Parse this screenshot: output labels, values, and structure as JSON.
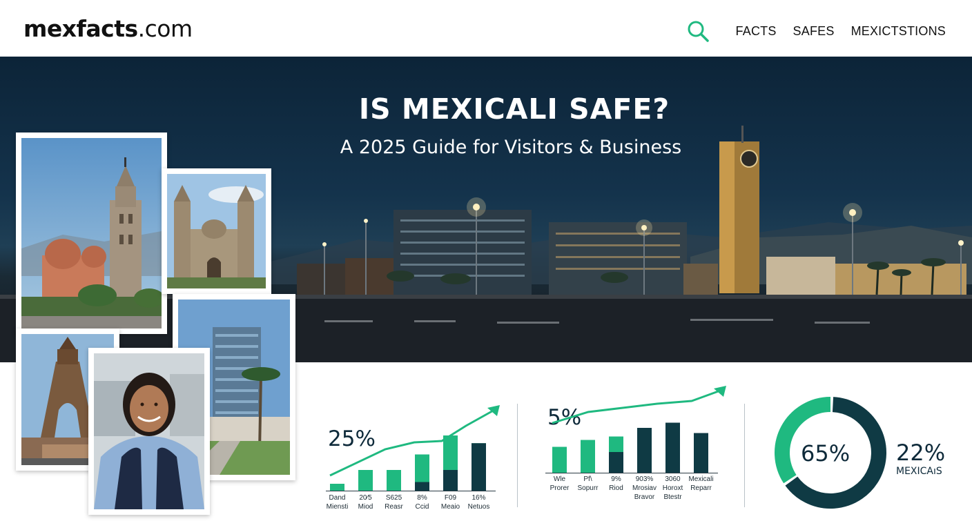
{
  "site": {
    "logo_bold": "mexfacts",
    "logo_tld": ".com"
  },
  "nav": {
    "items": [
      "FACTS",
      "SAFES",
      "MEXICTSTIONS"
    ]
  },
  "hero": {
    "title": "IS MEXICALI SAFE?",
    "subtitle": "A 2025 Guide for Visitors & Business"
  },
  "colors": {
    "accent": "#1fb980",
    "navy": "#0e2a3a",
    "teal_dark": "#0f3a44"
  },
  "icons": {
    "search": "search-icon"
  },
  "chart_data": [
    {
      "type": "bar",
      "headline": "25%",
      "categories": [
        "Dand\nMiensti",
        "20⁄5\nMiod",
        "S625\nReasr",
        "8%\nCcid",
        "F09\nMeaio",
        "16%\nNetuos"
      ],
      "series": [
        {
          "values": [
            8,
            24,
            24,
            42,
            64,
            55
          ]
        }
      ],
      "stacked_dark": [
        0,
        0,
        0,
        10,
        24,
        55
      ],
      "ylim": [
        0,
        80
      ]
    },
    {
      "type": "bar",
      "headline": "5%",
      "categories": [
        "Wle\nProrer",
        "Pf\\\nSopurr",
        "9%\nRiod",
        "903%\nMrosiav\nBravor",
        "3060\nHoroxt\nBtestr",
        "Mexicali\nReparr"
      ],
      "series": [
        {
          "values": [
            30,
            38,
            42,
            52,
            58,
            46
          ]
        }
      ],
      "stacked_dark": [
        0,
        0,
        24,
        52,
        58,
        46
      ],
      "ylim": [
        0,
        80
      ]
    },
    {
      "type": "pie",
      "center_label": "65%",
      "side_value": "22%",
      "side_label": "MEXICAıS",
      "slices": [
        65,
        35
      ]
    }
  ]
}
